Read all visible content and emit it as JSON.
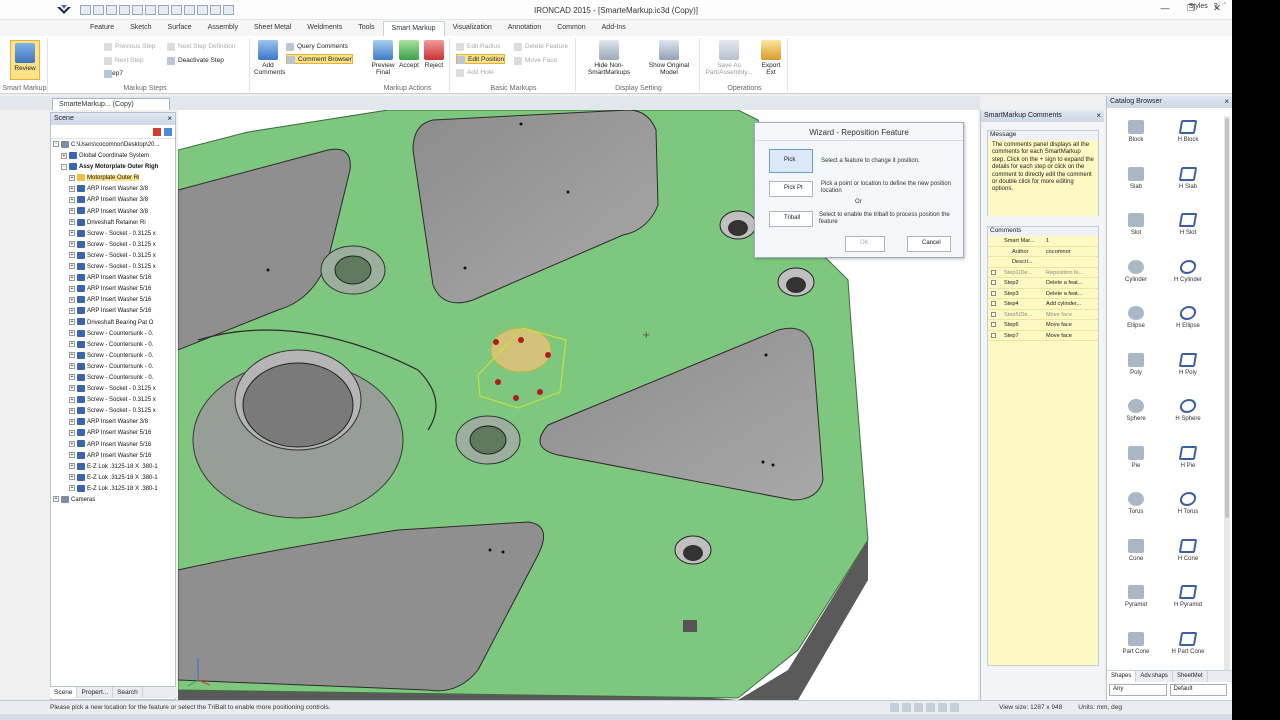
{
  "title": "IRONCAD 2015 - [SmarteMarkup.ic3d (Copy)]",
  "menu_right": {
    "styles": "Styles"
  },
  "tabs": [
    "Feature",
    "Sketch",
    "Surface",
    "Assembly",
    "Sheet Metal",
    "Weldments",
    "Tools",
    "Smart Markup",
    "Visualization",
    "Annotation",
    "Common",
    "Add-Ins"
  ],
  "ribbon": {
    "review": "Review",
    "previous_step": "Previous Step",
    "next_step": "Next Step",
    "step_value": "Step7",
    "next_step_definition": "Next Step Definition",
    "deactivate_step": "Deactivate Step",
    "add_comments": "Add Comments",
    "query_comments": "Query Comments",
    "comment_browser": "Comment Browser",
    "preview_final": "Preview Final",
    "accept": "Accept",
    "reject": "Reject",
    "edit_radius": "Edit Radius",
    "edit_position": "Edit Position",
    "add_hole": "Add Hole",
    "delete_feature": "Delete Feature",
    "move_face": "Move Face",
    "hide_non_smartmarkups": "Hide Non-SmartMarkups",
    "show_original_model": "Show Original Model",
    "save_as": "Save As Part/Assembly...",
    "export_ext": "Export Ext",
    "groups": [
      "Smart Markup",
      "Markup Steps",
      "Markup Actions",
      "Basic Markups",
      "Display Setting",
      "Operations"
    ]
  },
  "doc_tab": "SmarteMarkup... (Copy)",
  "scene": {
    "title": "Scene",
    "tree": [
      {
        "label": "C:\\Users\\cocomnor\\Desktop\\20...",
        "level": 0,
        "tog": "-"
      },
      {
        "label": "Global Coordinate System",
        "level": 1,
        "tog": "+"
      },
      {
        "label": "Assy Motorplate Outer Righ",
        "level": 1,
        "tog": "-",
        "bold": true
      },
      {
        "label": "Motorplate Outer Ri",
        "level": 2,
        "sel": true
      },
      {
        "label": "ARP Insert Washer 3/8",
        "level": 2
      },
      {
        "label": "ARP Insert Washer 3/8",
        "level": 2
      },
      {
        "label": "ARP Insert Washer 3/8",
        "level": 2
      },
      {
        "label": "Driveshaft Retainer Ri",
        "level": 2
      },
      {
        "label": "Screw - Socket - 0.3125 x",
        "level": 2
      },
      {
        "label": "Screw - Socket - 0.3125 x",
        "level": 2
      },
      {
        "label": "Screw - Socket - 0.3125 x",
        "level": 2
      },
      {
        "label": "Screw - Socket - 0.3125 x",
        "level": 2
      },
      {
        "label": "ARP Insert Washer 5/16",
        "level": 2
      },
      {
        "label": "ARP Insert Washer 5/16",
        "level": 2
      },
      {
        "label": "ARP Insert Washer 5/16",
        "level": 2
      },
      {
        "label": "ARP Insert Washer 5/16",
        "level": 2
      },
      {
        "label": "Driveshaft Bearing Pat O",
        "level": 2
      },
      {
        "label": "Screw - Countersunk - 0.",
        "level": 2
      },
      {
        "label": "Screw - Countersunk - 0.",
        "level": 2
      },
      {
        "label": "Screw - Countersunk - 0.",
        "level": 2
      },
      {
        "label": "Screw - Countersunk - 0.",
        "level": 2
      },
      {
        "label": "Screw - Countersunk - 0.",
        "level": 2
      },
      {
        "label": "Screw - Socket - 0.3125 x",
        "level": 2
      },
      {
        "label": "Screw - Socket - 0.3125 x",
        "level": 2
      },
      {
        "label": "Screw - Socket - 0.3125 x",
        "level": 2
      },
      {
        "label": "ARP Insert Washer 3/8",
        "level": 2
      },
      {
        "label": "ARP Insert Washer 5/16",
        "level": 2
      },
      {
        "label": "ARP Insert Washer 5/16",
        "level": 2
      },
      {
        "label": "ARP Insert Washer 5/16",
        "level": 2
      },
      {
        "label": "E-Z Lok .3125-18 X .380-1",
        "level": 2
      },
      {
        "label": "E-Z Lok .3125-18 X .380-1",
        "level": 2
      },
      {
        "label": "E-Z Lok .3125-18 X .380-1",
        "level": 2
      },
      {
        "label": "Cameras",
        "level": 0,
        "tog": "+"
      }
    ],
    "bottom_tabs": [
      "Scene",
      "Propert...",
      "Search"
    ]
  },
  "wizard": {
    "title": "Wizard - Reposition Feature",
    "pick": "Pick",
    "pick_desc": "Select a feature to change it position.",
    "pick_pt": "Pick Pt",
    "pick_pt_desc": "Pick a point or location to define the new position location",
    "or": "Or",
    "triball": "Triball",
    "triball_desc": "Select to enable the triball to process position the feature",
    "ok": "OK",
    "cancel": "Cancel"
  },
  "comments_panel": {
    "title": "SmartMarkup Comments",
    "message_header": "Message",
    "message": "The comments panel displays all the comments for each SmartMarkup step. Click on the + sign to expand the details for each step or click on the comment to directly edit the comment or double click for more editing options.",
    "comments_header": "Comments",
    "rows": [
      {
        "c1": "Smart Mar...",
        "c2": "1",
        "dim": false,
        "indent": false,
        "plus": false
      },
      {
        "c1": "Author",
        "c2": "cocomnor",
        "dim": false,
        "indent": true,
        "plus": false
      },
      {
        "c1": "Descri...",
        "c2": "",
        "dim": false,
        "indent": true,
        "plus": false
      },
      {
        "c1": "Step1(De...",
        "c2": "Reposition fe...",
        "dim": true,
        "indent": false,
        "plus": true
      },
      {
        "c1": "Step2",
        "c2": "Delete a feat...",
        "dim": false,
        "indent": false,
        "plus": true
      },
      {
        "c1": "Step3",
        "c2": "Delete a feat...",
        "dim": false,
        "indent": false,
        "plus": true
      },
      {
        "c1": "Step4",
        "c2": "Add cylinder...",
        "dim": false,
        "indent": false,
        "plus": true
      },
      {
        "c1": "Step5(De...",
        "c2": "Move face",
        "dim": true,
        "indent": false,
        "plus": true
      },
      {
        "c1": "Step6",
        "c2": "Move face",
        "dim": false,
        "indent": false,
        "plus": true
      },
      {
        "c1": "Step7",
        "c2": "Move face",
        "dim": false,
        "indent": false,
        "plus": true
      }
    ]
  },
  "catalog": {
    "title": "Catalog Browser",
    "items": [
      {
        "label": "Block",
        "icon": "block-icon"
      },
      {
        "label": "H Block",
        "icon": "h-block-icon"
      },
      {
        "label": "Slab",
        "icon": "slab-icon"
      },
      {
        "label": "H Slab",
        "icon": "h-slab-icon"
      },
      {
        "label": "Slot",
        "icon": "slot-icon"
      },
      {
        "label": "H Slot",
        "icon": "h-slot-icon"
      },
      {
        "label": "Cylinder",
        "icon": "cylinder-icon"
      },
      {
        "label": "H Cylinder",
        "icon": "h-cylinder-icon"
      },
      {
        "label": "Ellipse",
        "icon": "ellipse-icon"
      },
      {
        "label": "H Ellipse",
        "icon": "h-ellipse-icon"
      },
      {
        "label": "Poly",
        "icon": "poly-icon"
      },
      {
        "label": "H Poly",
        "icon": "h-poly-icon"
      },
      {
        "label": "Sphere",
        "icon": "sphere-icon"
      },
      {
        "label": "H Sphere",
        "icon": "h-sphere-icon"
      },
      {
        "label": "Pie",
        "icon": "pie-icon"
      },
      {
        "label": "H Pie",
        "icon": "h-pie-icon"
      },
      {
        "label": "Torus",
        "icon": "torus-icon"
      },
      {
        "label": "H Torus",
        "icon": "h-torus-icon"
      },
      {
        "label": "Cone",
        "icon": "cone-icon"
      },
      {
        "label": "H Cone",
        "icon": "h-cone-icon"
      },
      {
        "label": "Pyramid",
        "icon": "pyramid-icon"
      },
      {
        "label": "H Pyramid",
        "icon": "h-pyramid-icon"
      },
      {
        "label": "Part Cone",
        "icon": "part-cone-icon"
      },
      {
        "label": "H Part Cone",
        "icon": "h-part-cone-icon"
      }
    ],
    "bottom_tabs": [
      "Shapes",
      "Adv.shaps",
      "SheetMet"
    ],
    "selects": [
      "Any",
      "Default"
    ]
  },
  "status": {
    "text": "Please pick a new location for the feature or select the TriBall to enable more positioning controls.",
    "view_size": "View size: 1287 x 948",
    "units": "Units: mm, deg"
  },
  "colors": {
    "part_green": "#7ec77e",
    "highlight": "#fde28a",
    "accent": "#3a64b0"
  }
}
